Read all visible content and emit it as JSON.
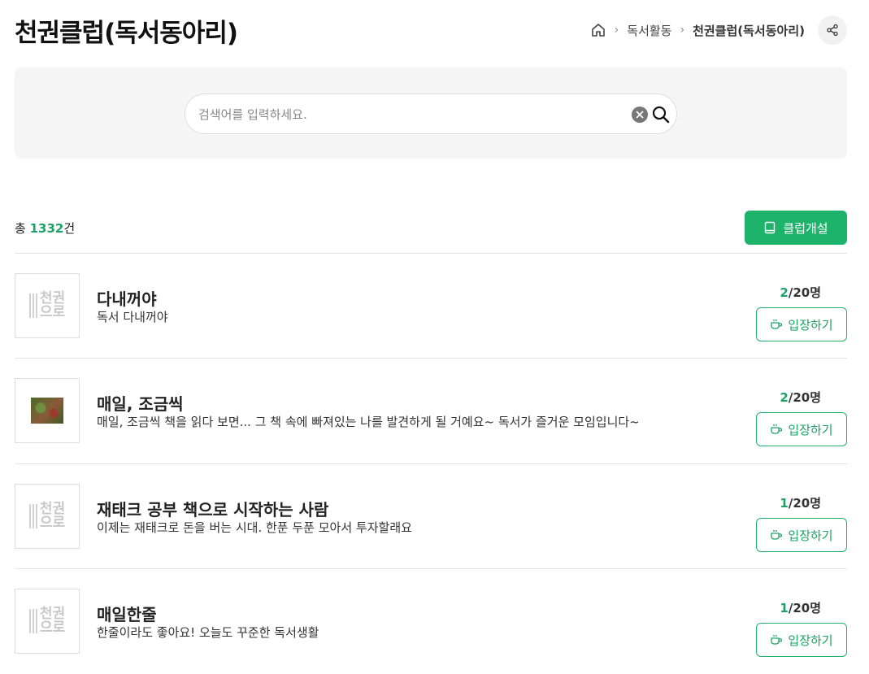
{
  "header": {
    "title": "천권클럽(독서동아리)",
    "breadcrumb": [
      "독서활동",
      "천권클럽(독서동아리)"
    ]
  },
  "search": {
    "placeholder": "검색어를 입력하세요.",
    "value": ""
  },
  "summary": {
    "prefix": "총 ",
    "count": "1332",
    "suffix": "건"
  },
  "open_club_label": "클럽개설",
  "placeholder_logo_text": "천권 으로",
  "clubs": [
    {
      "name": "다내꺼야",
      "description": "독서 다내꺼야",
      "current": "2",
      "max": "/20명",
      "enter_label": "입장하기",
      "thumbnail": "placeholder-logo"
    },
    {
      "name": "매일, 조금씩",
      "description": "매일, 조금씩 책을 읽다 보면... 그 책 속에 빠져있는 나를 발견하게 될 거예요~ 독서가 즐거운 모임입니다~",
      "current": "2",
      "max": "/20명",
      "enter_label": "입장하기",
      "thumbnail": "photo"
    },
    {
      "name": "재태크 공부 책으로 시작하는 사람",
      "description": "이제는 재태크로 돈을 버는 시대. 한푼 두푼 모아서 투자할래요",
      "current": "1",
      "max": "/20명",
      "enter_label": "입장하기",
      "thumbnail": "placeholder-logo"
    },
    {
      "name": "매일한줄",
      "description": "한줄이라도 좋아요! 오늘도 꾸준한 독서생활",
      "current": "1",
      "max": "/20명",
      "enter_label": "입장하기",
      "thumbnail": "placeholder-logo"
    }
  ],
  "colors": {
    "accent": "#1db36b",
    "accent_text": "#1aa463"
  }
}
